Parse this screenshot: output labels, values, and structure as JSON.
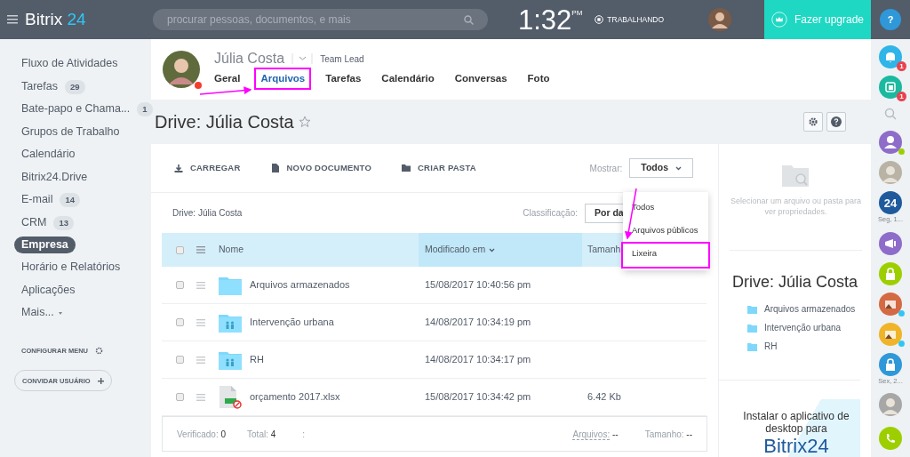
{
  "header": {
    "logo_main": "Bitrix",
    "logo_accent": "24",
    "search_placeholder": "procurar pessoas, documentos, e mais",
    "time": "1:32",
    "time_suffix": "PM",
    "work_status": "TRABALHANDO",
    "upgrade": "Fazer upgrade",
    "help": "?"
  },
  "sidebar": {
    "items": [
      {
        "label": "Fluxo de Atividades",
        "selected": false
      },
      {
        "label": "Tarefas",
        "count": "29",
        "selected": false
      },
      {
        "label": "Bate-papo e Chama...",
        "count": "1",
        "selected": false
      },
      {
        "label": "Grupos de Trabalho",
        "selected": false
      },
      {
        "label": "Calendário",
        "selected": false
      },
      {
        "label": "Bitrix24.Drive",
        "selected": false
      },
      {
        "label": "E-mail",
        "count": "14",
        "selected": false
      },
      {
        "label": "CRM",
        "count": "13",
        "selected": false
      },
      {
        "label": "Empresa",
        "selected": true
      },
      {
        "label": "Horário e Relatórios",
        "selected": false
      },
      {
        "label": "Aplicações",
        "selected": false
      },
      {
        "label": "Mais...",
        "selected": false,
        "has_caret": true
      }
    ],
    "configure": "CONFIGURAR MENU",
    "invite": "CONVIDAR USUÁRIO"
  },
  "profile": {
    "name": "Júlia Costa",
    "role": "Team Lead",
    "tabs": [
      {
        "label": "Geral",
        "selected": false,
        "annotated": false
      },
      {
        "label": "Arquivos",
        "selected": true,
        "annotated": true
      },
      {
        "label": "Tarefas",
        "selected": false,
        "annotated": false
      },
      {
        "label": "Calendário",
        "selected": false,
        "annotated": false
      },
      {
        "label": "Conversas",
        "selected": false,
        "annotated": false
      },
      {
        "label": "Foto",
        "selected": false,
        "annotated": false
      }
    ]
  },
  "page_title": "Drive: Júlia Costa",
  "toolbar": {
    "actions": [
      {
        "label": "CARREGAR",
        "kind": "upload"
      },
      {
        "label": "NOVO DOCUMENTO",
        "kind": "document"
      },
      {
        "label": "CRIAR PASTA",
        "kind": "folder"
      }
    ],
    "show_label": "Mostrar:",
    "show_value": "Todos"
  },
  "breadcrumb": "Drive: Júlia Costa",
  "sort_label": "Classificação:",
  "sort_value": "Por da",
  "show_menu": {
    "options": [
      {
        "label": "Todos",
        "annotated": false
      },
      {
        "label": "Arquivos públicos",
        "annotated": false
      },
      {
        "label": "Lixeira",
        "annotated": true
      }
    ]
  },
  "table": {
    "columns": [
      "Nome",
      "Modificado em",
      "Tamanh"
    ],
    "all_checked": false,
    "rows": [
      {
        "name": "Arquivos armazenados",
        "modified": "15/08/2017 10:40:56 pm",
        "kind": "folder",
        "checked": false
      },
      {
        "name": "Intervenção urbana",
        "modified": "14/08/2017 10:34:19 pm",
        "kind": "shared",
        "checked": false
      },
      {
        "name": "RH",
        "modified": "14/08/2017 10:34:17 pm",
        "kind": "shared",
        "checked": false
      },
      {
        "name": "orçamento 2017.xlsx",
        "modified": "15/08/2017 10:34:42 pm",
        "size": "6.42 Kb",
        "kind": "spreadsheet",
        "checked": false
      }
    ]
  },
  "footer": {
    "checked_label": "Verificado:",
    "checked": "0",
    "total_label": "Total:",
    "total": "4",
    "separator": ":",
    "files_label": "Arquivos:",
    "files": "--",
    "size_label": "Tamanho:",
    "size": "--"
  },
  "details": {
    "hint": "Selecionar um arquivo ou pasta para ver propriedades.",
    "title": "Drive: Júlia Costa",
    "folders": [
      "Arquivos armazenados",
      "Intervenção urbana",
      "RH"
    ],
    "promo_text": "Instalar o aplicativo de desktop para",
    "promo_brand": "Bitrix24"
  },
  "rail": [
    {
      "kind": "bell",
      "color": "#2fb5e8",
      "badge": "1"
    },
    {
      "kind": "chat",
      "color": "#1bb99f",
      "badge": "1"
    },
    {
      "kind": "search"
    },
    {
      "kind": "user",
      "color": "#8e6cc9",
      "status_dot": true
    },
    {
      "kind": "avatar",
      "color": "#b9b3a6"
    },
    {
      "kind": "brand",
      "color": "#1f5a9c",
      "text": "24",
      "caption": "Seg, 1..."
    },
    {
      "kind": "megaphone",
      "color": "#8e6cc9"
    },
    {
      "kind": "lock",
      "color": "#9dcf00"
    },
    {
      "kind": "picture",
      "color": "#d46a43",
      "status_dot": true
    },
    {
      "kind": "picture",
      "color": "#f0b429",
      "status_dot": true
    },
    {
      "kind": "lock",
      "color": "#2f98d8",
      "caption": "Sex, 2..."
    },
    {
      "kind": "avatar",
      "color": "#a7a7a7"
    }
  ]
}
